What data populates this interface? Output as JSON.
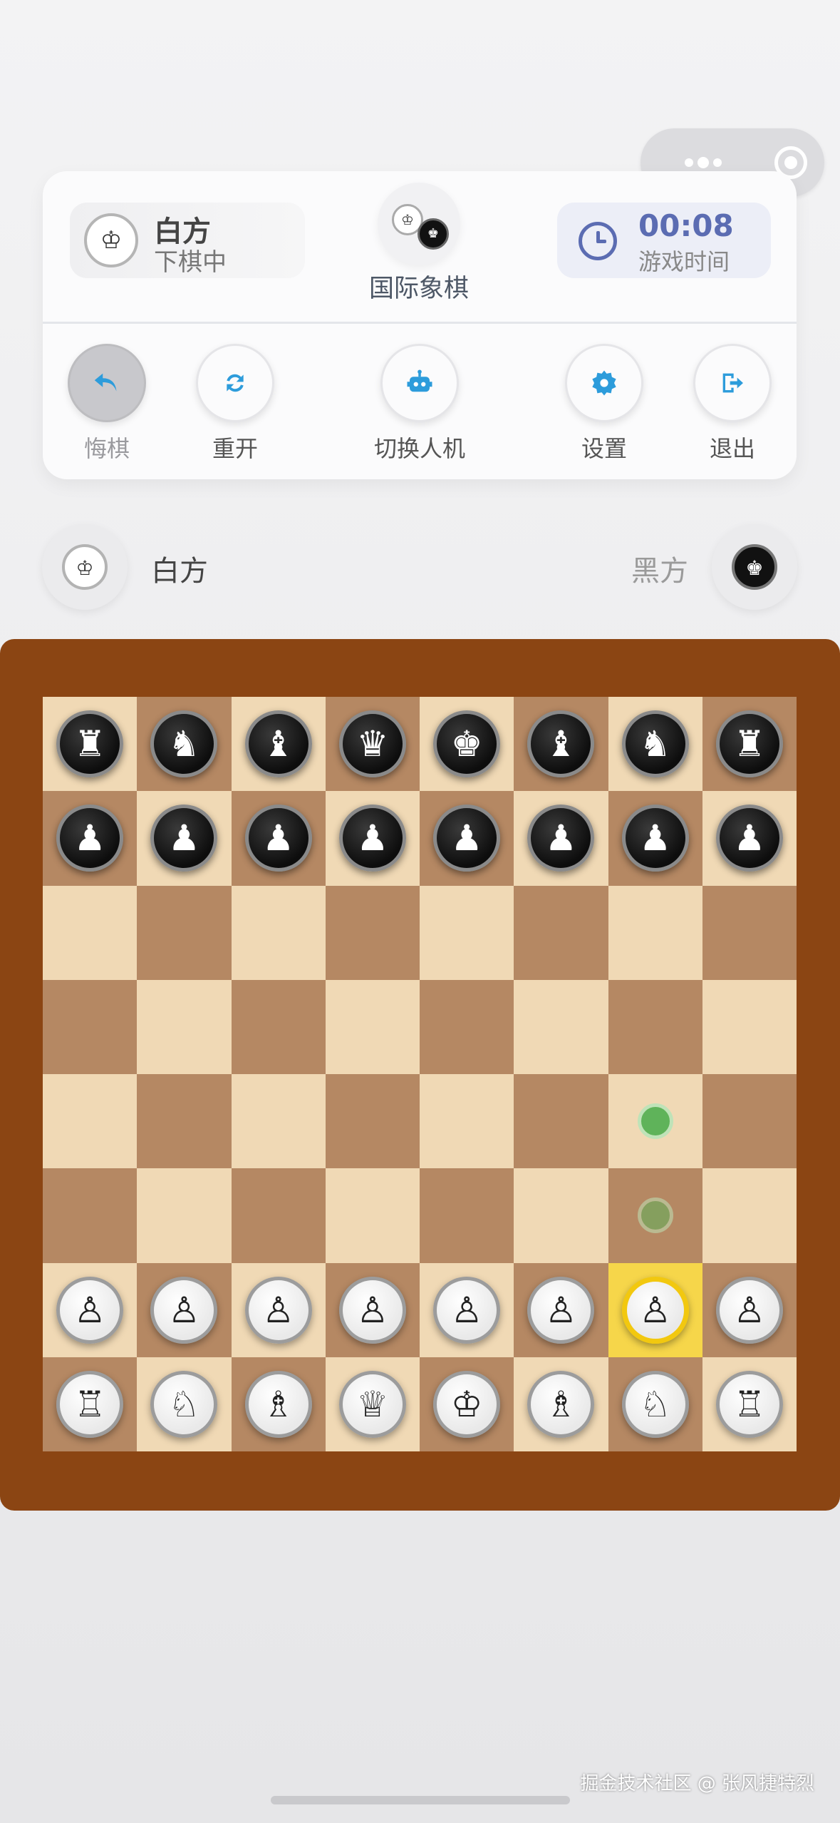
{
  "status": {
    "current_side": "白方",
    "current_state": "下棋中",
    "game_title": "国际象棋",
    "timer_value": "00:08",
    "timer_label": "游戏时间"
  },
  "toolbar": {
    "undo_label": "悔棋",
    "restart_label": "重开",
    "switch_ai_label": "切换人机",
    "settings_label": "设置",
    "exit_label": "退出"
  },
  "players": {
    "white_name": "白方",
    "black_name": "黑方",
    "active": "white"
  },
  "board": {
    "rows": [
      [
        "♜",
        "♞",
        "♝",
        "♛",
        "♚",
        "♝",
        "♞",
        "♜"
      ],
      [
        "♟",
        "♟",
        "♟",
        "♟",
        "♟",
        "♟",
        "♟",
        "♟"
      ],
      [
        "",
        "",
        "",
        "",
        "",
        "",
        "",
        ""
      ],
      [
        "",
        "",
        "",
        "",
        "",
        "",
        "",
        ""
      ],
      [
        "",
        "",
        "",
        "",
        "",
        "",
        "",
        ""
      ],
      [
        "",
        "",
        "",
        "",
        "",
        "",
        "",
        ""
      ],
      [
        "♙",
        "♙",
        "♙",
        "♙",
        "♙",
        "♙",
        "♙",
        "♙"
      ],
      [
        "♖",
        "♘",
        "♗",
        "♕",
        "♔",
        "♗",
        "♘",
        "♖"
      ]
    ],
    "selected": "g2",
    "move_hints": [
      "g4",
      "g3"
    ]
  },
  "colors": {
    "accent": "#5b6cb2",
    "icon_blue": "#2d9cdb",
    "frame": "#8b4513",
    "light_square": "#f0d9b5",
    "dark_square": "#b58863",
    "highlight": "#f6d64a",
    "hint": "#5fb35a"
  },
  "icons": {
    "undo": "undo-arrow-icon",
    "restart": "refresh-icon",
    "switch_ai": "robot-icon",
    "settings": "gear-icon",
    "exit": "exit-icon",
    "timer": "clock-icon"
  },
  "footer": {
    "watermark": "掘金技术社区 @ 张风捷特烈"
  }
}
